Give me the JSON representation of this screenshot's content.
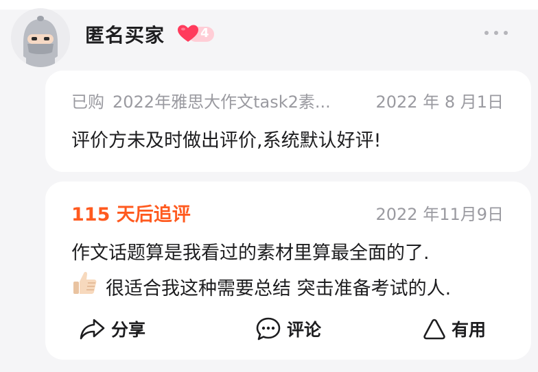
{
  "user": {
    "name": "匿名买家",
    "level": "4",
    "avatar_icon": "ninja-avatar-icon",
    "colors": {
      "heart": "#ff3b5c",
      "badge": "#ffcdd6"
    }
  },
  "review": {
    "purchased_label": "已购",
    "product": "2022年雅思大作文task2素...",
    "date": "2022 年 8 月1日",
    "text": "评价方未及时做出评价,系统默认好评!"
  },
  "followup": {
    "label": "115 天后追评",
    "date": "2022 年11月9日",
    "line1": "作文话题算是我看过的素材里算最全面的了.",
    "line2": "很适合我这种需要总结 突击准备考试的人.",
    "emoji_icon": "thumbs-up-icon",
    "accent": "#ff5a1f"
  },
  "actions": {
    "share": "分享",
    "comment": "评论",
    "useful": "有用"
  }
}
